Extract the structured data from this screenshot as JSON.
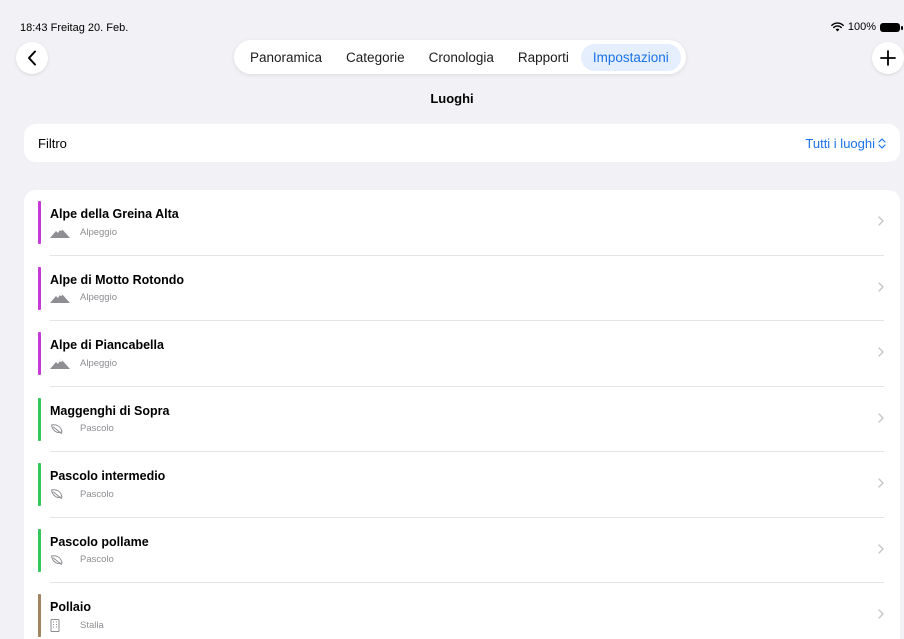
{
  "status": {
    "time": "18:43",
    "date": "Freitag 20. Feb.",
    "battery": "100%"
  },
  "nav": {
    "back_icon": "chevron-left-icon",
    "add_icon": "plus-icon",
    "tabs": [
      {
        "label": "Panoramica",
        "active": false
      },
      {
        "label": "Categorie",
        "active": false
      },
      {
        "label": "Cronologia",
        "active": false
      },
      {
        "label": "Rapporti",
        "active": false
      },
      {
        "label": "Impostazioni",
        "active": true
      }
    ]
  },
  "page": {
    "title": "Luoghi"
  },
  "filter": {
    "label": "Filtro",
    "value": "Tutti i luoghi"
  },
  "places": [
    {
      "name": "Alpe della Greina Alta",
      "type": "Alpeggio",
      "icon": "mountain-icon",
      "color": "#c53ad6"
    },
    {
      "name": "Alpe di Motto Rotondo",
      "type": "Alpeggio",
      "icon": "mountain-icon",
      "color": "#c53ad6"
    },
    {
      "name": "Alpe di Piancabella",
      "type": "Alpeggio",
      "icon": "mountain-icon",
      "color": "#c53ad6"
    },
    {
      "name": "Maggenghi di Sopra",
      "type": "Pascolo",
      "icon": "leaf-icon",
      "color": "#34c759"
    },
    {
      "name": "Pascolo intermedio",
      "type": "Pascolo",
      "icon": "leaf-icon",
      "color": "#34c759"
    },
    {
      "name": "Pascolo pollame",
      "type": "Pascolo",
      "icon": "leaf-icon",
      "color": "#34c759"
    },
    {
      "name": "Pollaio",
      "type": "Stalla",
      "icon": "building-icon",
      "color": "#a2845e"
    }
  ],
  "colors": {
    "accent": "#1a73e8",
    "background": "#f2f2f6"
  }
}
